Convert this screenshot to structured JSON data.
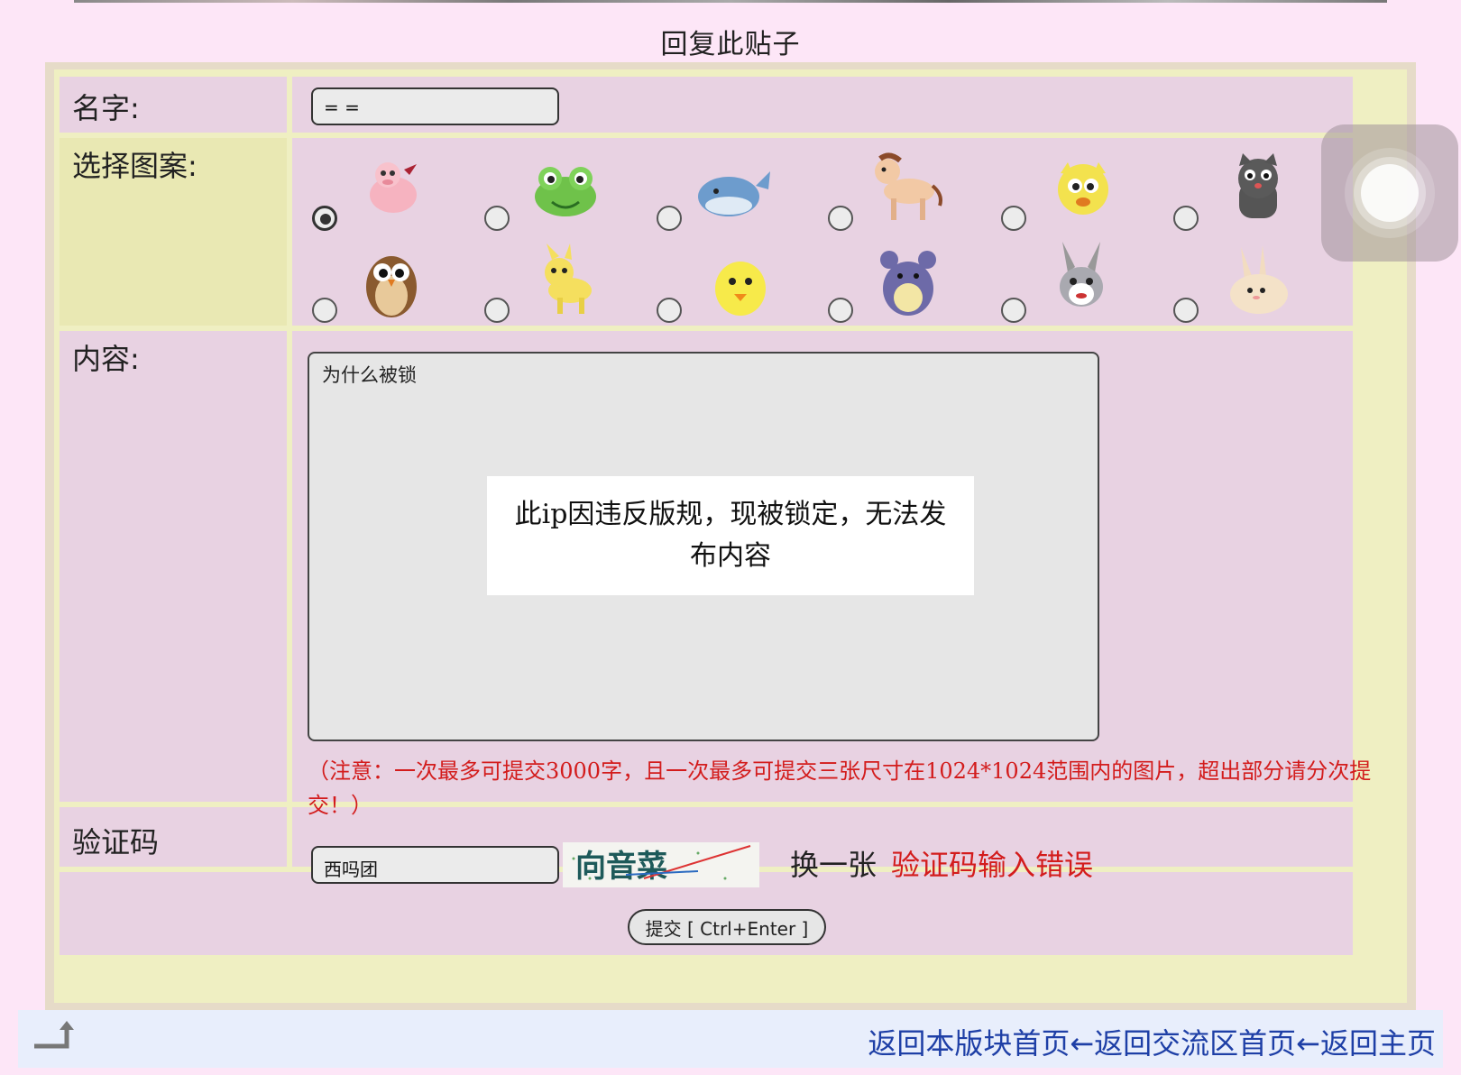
{
  "page_title": "回复此贴子",
  "form": {
    "name_label": "名字:",
    "name_value": "= =",
    "pattern_label": "选择图案:",
    "patterns": [
      {
        "icon": "pig-icon",
        "selected": true
      },
      {
        "icon": "frog-icon",
        "selected": false
      },
      {
        "icon": "whale-icon",
        "selected": false
      },
      {
        "icon": "horse-icon",
        "selected": false
      },
      {
        "icon": "cat-face-icon",
        "selected": false
      },
      {
        "icon": "gray-cat-icon",
        "selected": false
      },
      {
        "icon": "owl-icon",
        "selected": false
      },
      {
        "icon": "pikachu-icon",
        "selected": false
      },
      {
        "icon": "chick-icon",
        "selected": false
      },
      {
        "icon": "mouse-icon",
        "selected": false
      },
      {
        "icon": "bunny-icon",
        "selected": false
      },
      {
        "icon": "rabbit-icon",
        "selected": false
      }
    ],
    "content_label": "内容:",
    "content_value": "为什么被锁",
    "note": "（注意：一次最多可提交3000字，且一次最多可提交三张尺寸在1024*1024范围内的图片，超出部分请分次提交！）",
    "captcha_label": "验证码",
    "captcha_value": "西吗团",
    "captcha_image_text": "向音菜",
    "captcha_refresh": "换一张",
    "captcha_error": "验证码输入错误",
    "submit_label": "提交 [ Ctrl+Enter ]"
  },
  "toast": {
    "message": "此ip因违反版规，现被锁定，无法发布内容"
  },
  "footer": {
    "link_board": "返回本版块首页",
    "arrow1": "←",
    "link_community": "返回交流区首页",
    "arrow2": "←",
    "link_home": "返回主页"
  },
  "colors": {
    "page_bg": "#fde6f7",
    "row_bg": "#e8d2e2",
    "label_highlight": "#e9e8b3",
    "error_red": "#d31c1c",
    "link_blue": "#1e3fa6"
  }
}
